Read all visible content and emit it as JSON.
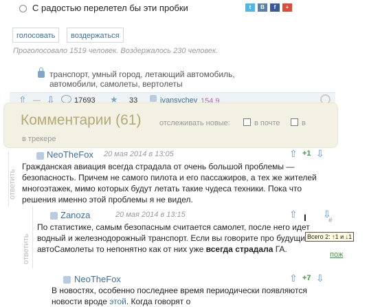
{
  "poll": {
    "option": "С радостью перелетел бы эти пробки",
    "vote_label": "голосовать",
    "abstain_label": "воздержаться",
    "stats": "Проголосовало 1519 человек. Воздержалось 230 человек."
  },
  "tags": "транспорт, умный город, летающий автомобиль, автомобили, самолеты, вертолеты",
  "infobar": {
    "views": "17693",
    "favorites": "33",
    "author": "ivansychev",
    "karma": "154,9"
  },
  "comments_header": {
    "title": "Комментарии (61)",
    "track_label": "отслеживать новые:",
    "option_mail": "в почте",
    "option_tracker": "в трекере"
  },
  "comments": [
    {
      "author": "NeoTheFox",
      "date": "20 мая 2014 в 13:05",
      "score": "+1",
      "reply_label": "ответить",
      "body": "Гражданская авиация всегда страдала от очень большой проблемы — безопасность. Причем не самого пилота и его пассажиров, а тех же жителей многоэтажек, мимо которых будут летать такие чудеса техники. Пока что решения именно этой проблемы я не видел."
    },
    {
      "author": "Zanoza",
      "date": "20 мая 2014 в 13:15",
      "reply_label": "ответить",
      "body_start": "По статистике, самым безопасным считается самолет, после него идет водный и железнодорожный транспорт. Если вы говорите про будущие автоСамолеты то непонятно как от них уже ",
      "body_bold": "всегда страдала",
      "body_end": " ГА.",
      "badge": "пож"
    },
    {
      "author": "NeoTheFox",
      "score": "+7",
      "body_start": "В новостях, особенно последнее время периодически появляются новости вроде ",
      "body_link": "этой",
      "body_end": ". Когда говорят о"
    }
  ],
  "tooltip": "Всего 2: ↑1 и ↓1",
  "colors": {
    "link": "#3b6e9c",
    "positive": "#3b9e3b",
    "comments_header_bg": "#f3f1e4",
    "muted": "#999999"
  }
}
